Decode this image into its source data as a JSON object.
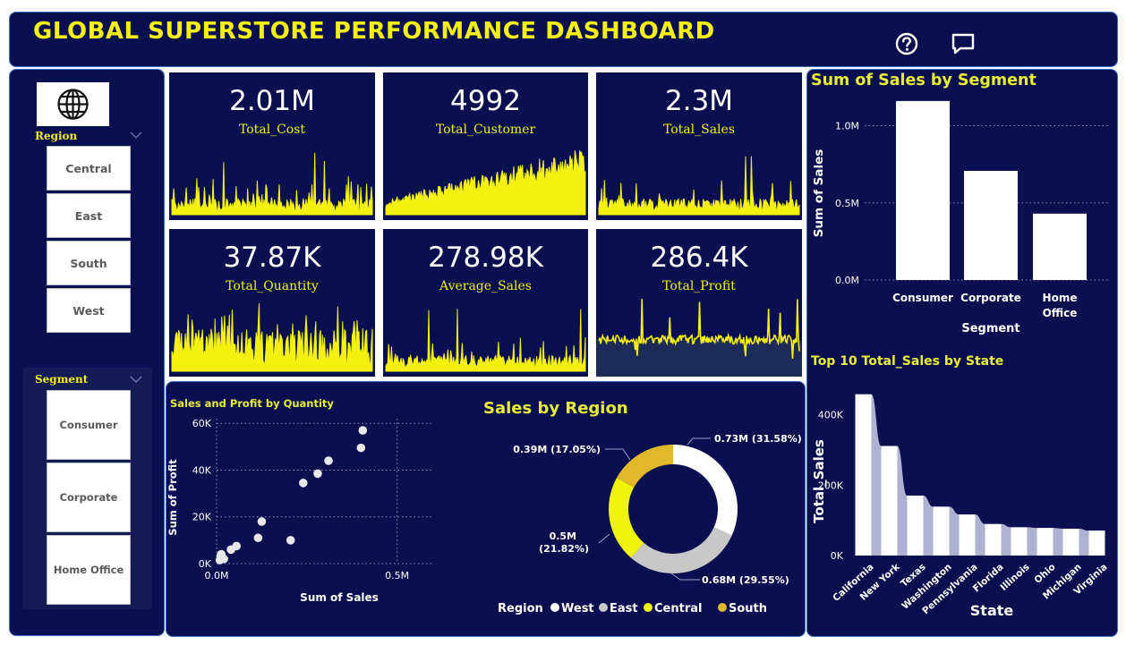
{
  "header": {
    "title": "GLOBAL SUPERSTORE PERFORMANCE DASHBOARD",
    "icons": [
      "help-icon",
      "comment-icon"
    ]
  },
  "colors": {
    "panel": "#0a0f4f",
    "accent_yellow": "#f4f10f",
    "border": "#3a6fc4"
  },
  "filters": {
    "region_label": "Region",
    "regions": [
      "Central",
      "East",
      "South",
      "West"
    ],
    "segment_label": "Segment",
    "segments": [
      "Consumer",
      "Corporate",
      "Home Office"
    ]
  },
  "kpis": [
    {
      "value": "2.01M",
      "label": "Total_Cost"
    },
    {
      "value": "4992",
      "label": "Total_Customer"
    },
    {
      "value": "2.3M",
      "label": "Total_Sales"
    },
    {
      "value": "37.87K",
      "label": "Total_Quantity"
    },
    {
      "value": "278.98K",
      "label": "Average_Sales"
    },
    {
      "value": "286.4K",
      "label": "Total_Profit"
    }
  ],
  "chart_data": [
    {
      "id": "segment",
      "type": "bar",
      "title": "Sum of Sales by Segment",
      "xlabel": "Segment",
      "ylabel": "Sum of Sales",
      "categories": [
        "Consumer",
        "Corporate",
        "Home Office"
      ],
      "values": [
        1160000,
        707000,
        430000
      ],
      "ylim": [
        0,
        1200000
      ],
      "yticks": [
        "0.0M",
        "0.5M",
        "1.0M"
      ],
      "grid": true
    },
    {
      "id": "state",
      "type": "bar",
      "title": "Top 10 Total_Sales by State",
      "xlabel": "State",
      "ylabel": "Total_Sales",
      "categories": [
        "California",
        "New York",
        "Texas",
        "Washington",
        "Pennsylvania",
        "Florida",
        "Illinois",
        "Ohio",
        "Michigan",
        "Virginia"
      ],
      "values": [
        457688,
        310876,
        170188,
        138641,
        116512,
        89474,
        80166,
        78258,
        76270,
        70637
      ],
      "ylim": [
        0,
        480000
      ],
      "yticks": [
        "0K",
        "200K",
        "400K"
      ],
      "overlay": "area"
    },
    {
      "id": "scatter",
      "type": "scatter",
      "title": "Sales and Profit by Quantity",
      "xlabel": "Sum of Sales",
      "ylabel": "Sum of Profit",
      "xticks": [
        "0.0M",
        "0.5M"
      ],
      "yticks": [
        "0K",
        "20K",
        "40K",
        "60K"
      ],
      "xlim": [
        0,
        600000
      ],
      "ylim": [
        0,
        62000
      ],
      "points": [
        [
          9000,
          1500
        ],
        [
          11000,
          3200
        ],
        [
          13000,
          4000
        ],
        [
          16000,
          2500
        ],
        [
          20000,
          2000
        ],
        [
          40000,
          6000
        ],
        [
          55000,
          7500
        ],
        [
          115000,
          11000
        ],
        [
          125000,
          18000
        ],
        [
          205000,
          10000
        ],
        [
          240000,
          34500
        ],
        [
          280000,
          38500
        ],
        [
          310000,
          44000
        ],
        [
          400000,
          49500
        ],
        [
          405000,
          57000
        ]
      ],
      "grid": true
    },
    {
      "id": "region",
      "type": "pie",
      "style": "donut",
      "title": "Sales by Region",
      "legend_title": "Region",
      "legend_position": "bottom",
      "slices": [
        {
          "name": "West",
          "value": 0.73,
          "label": "0.73M (31.58%)",
          "color": "#ffffff"
        },
        {
          "name": "East",
          "value": 0.68,
          "label": "0.68M (29.55%)",
          "color": "#c8c8c8"
        },
        {
          "name": "Central",
          "value": 0.5,
          "label_line1": "0.5M",
          "label_line2": "(21.82%)",
          "color": "#eef40c"
        },
        {
          "name": "South",
          "value": 0.39,
          "label": "0.39M (17.05%)",
          "color": "#e0b82c"
        }
      ]
    }
  ]
}
